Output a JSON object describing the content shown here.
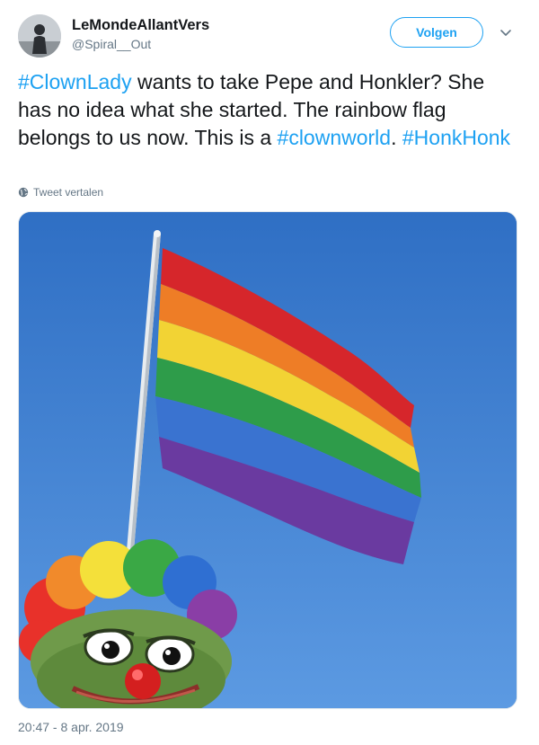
{
  "user": {
    "display_name": "LeMondeAllantVers",
    "handle": "@Spiral__Out",
    "avatar_icon": "person-silhouette-avatar"
  },
  "follow_button": {
    "label": "Volgen",
    "color": "#1da1f2"
  },
  "menu_icon": "chevron-down-icon",
  "tweet": {
    "segments": [
      {
        "text": "#ClownLady",
        "type": "hashtag"
      },
      {
        "text": " wants to take Pepe and Honkler? She has no idea what she started. The rainbow flag belongs to us now. This is a ",
        "type": "text"
      },
      {
        "text": "#clownworld",
        "type": "hashtag"
      },
      {
        "text": ". ",
        "type": "text"
      },
      {
        "text": "#HonkHonk",
        "type": "hashtag"
      }
    ]
  },
  "translate": {
    "label": "Tweet vertalen",
    "icon": "globe-icon"
  },
  "media": {
    "description_icon": "rainbow-flag-with-clown-frog-image"
  },
  "timestamp": "20:47 - 8 apr. 2019",
  "colors": {
    "hashtag": "#1da1f2",
    "text": "#14171a",
    "muted": "#657786",
    "sky": "#3f7fd0"
  }
}
